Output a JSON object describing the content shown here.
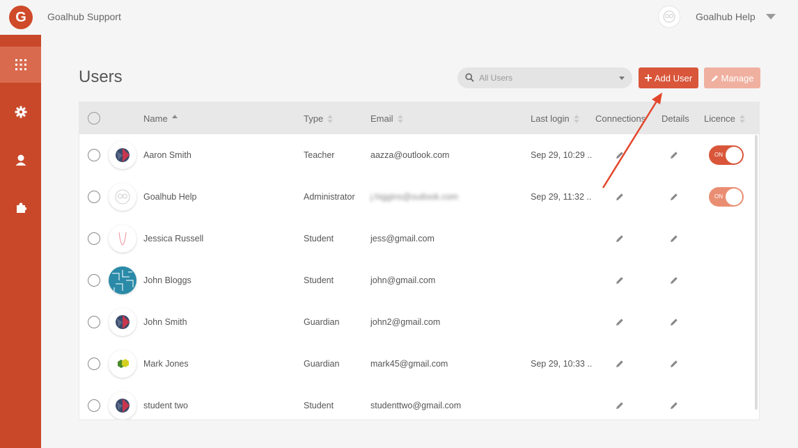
{
  "app": {
    "logo_letter": "G",
    "title": "Goalhub Support"
  },
  "account": {
    "name": "Goalhub Help"
  },
  "sidebar": {
    "items": [
      {
        "icon": "grid-icon",
        "active": true
      },
      {
        "icon": "gear-icon",
        "active": false
      },
      {
        "icon": "user-icon",
        "active": false
      },
      {
        "icon": "puzzle-icon",
        "active": false
      }
    ]
  },
  "page": {
    "title": "Users"
  },
  "search": {
    "placeholder": "All Users"
  },
  "buttons": {
    "add_user": "Add User",
    "manage": "Manage"
  },
  "colors": {
    "accent": "#d9563a",
    "sidebar": "#c9482a"
  },
  "table": {
    "columns": {
      "name": "Name",
      "type": "Type",
      "email": "Email",
      "last_login": "Last login",
      "connections": "Connections",
      "details": "Details",
      "licence": "Licence"
    },
    "rows": [
      {
        "name": "Aaron Smith",
        "type": "Teacher",
        "email": "aazza@outlook.com",
        "last_login": "Sep 29, 10:29 ..",
        "licence": "ON"
      },
      {
        "name": "Goalhub Help",
        "type": "Administrator",
        "email": "j.higgins@outlook.com",
        "last_login": "Sep 29, 11:32 ..",
        "licence": "ON"
      },
      {
        "name": "Jessica Russell",
        "type": "Student",
        "email": "jess@gmail.com",
        "last_login": "",
        "licence": ""
      },
      {
        "name": "John Bloggs",
        "type": "Student",
        "email": "john@gmail.com",
        "last_login": "",
        "licence": ""
      },
      {
        "name": "John Smith",
        "type": "Guardian",
        "email": "john2@gmail.com",
        "last_login": "",
        "licence": ""
      },
      {
        "name": "Mark Jones",
        "type": "Guardian",
        "email": "mark45@gmail.com",
        "last_login": "Sep 29, 10:33 ..",
        "licence": ""
      },
      {
        "name": "student two",
        "type": "Student",
        "email": "studenttwo@gmail.com",
        "last_login": "",
        "licence": ""
      }
    ]
  }
}
